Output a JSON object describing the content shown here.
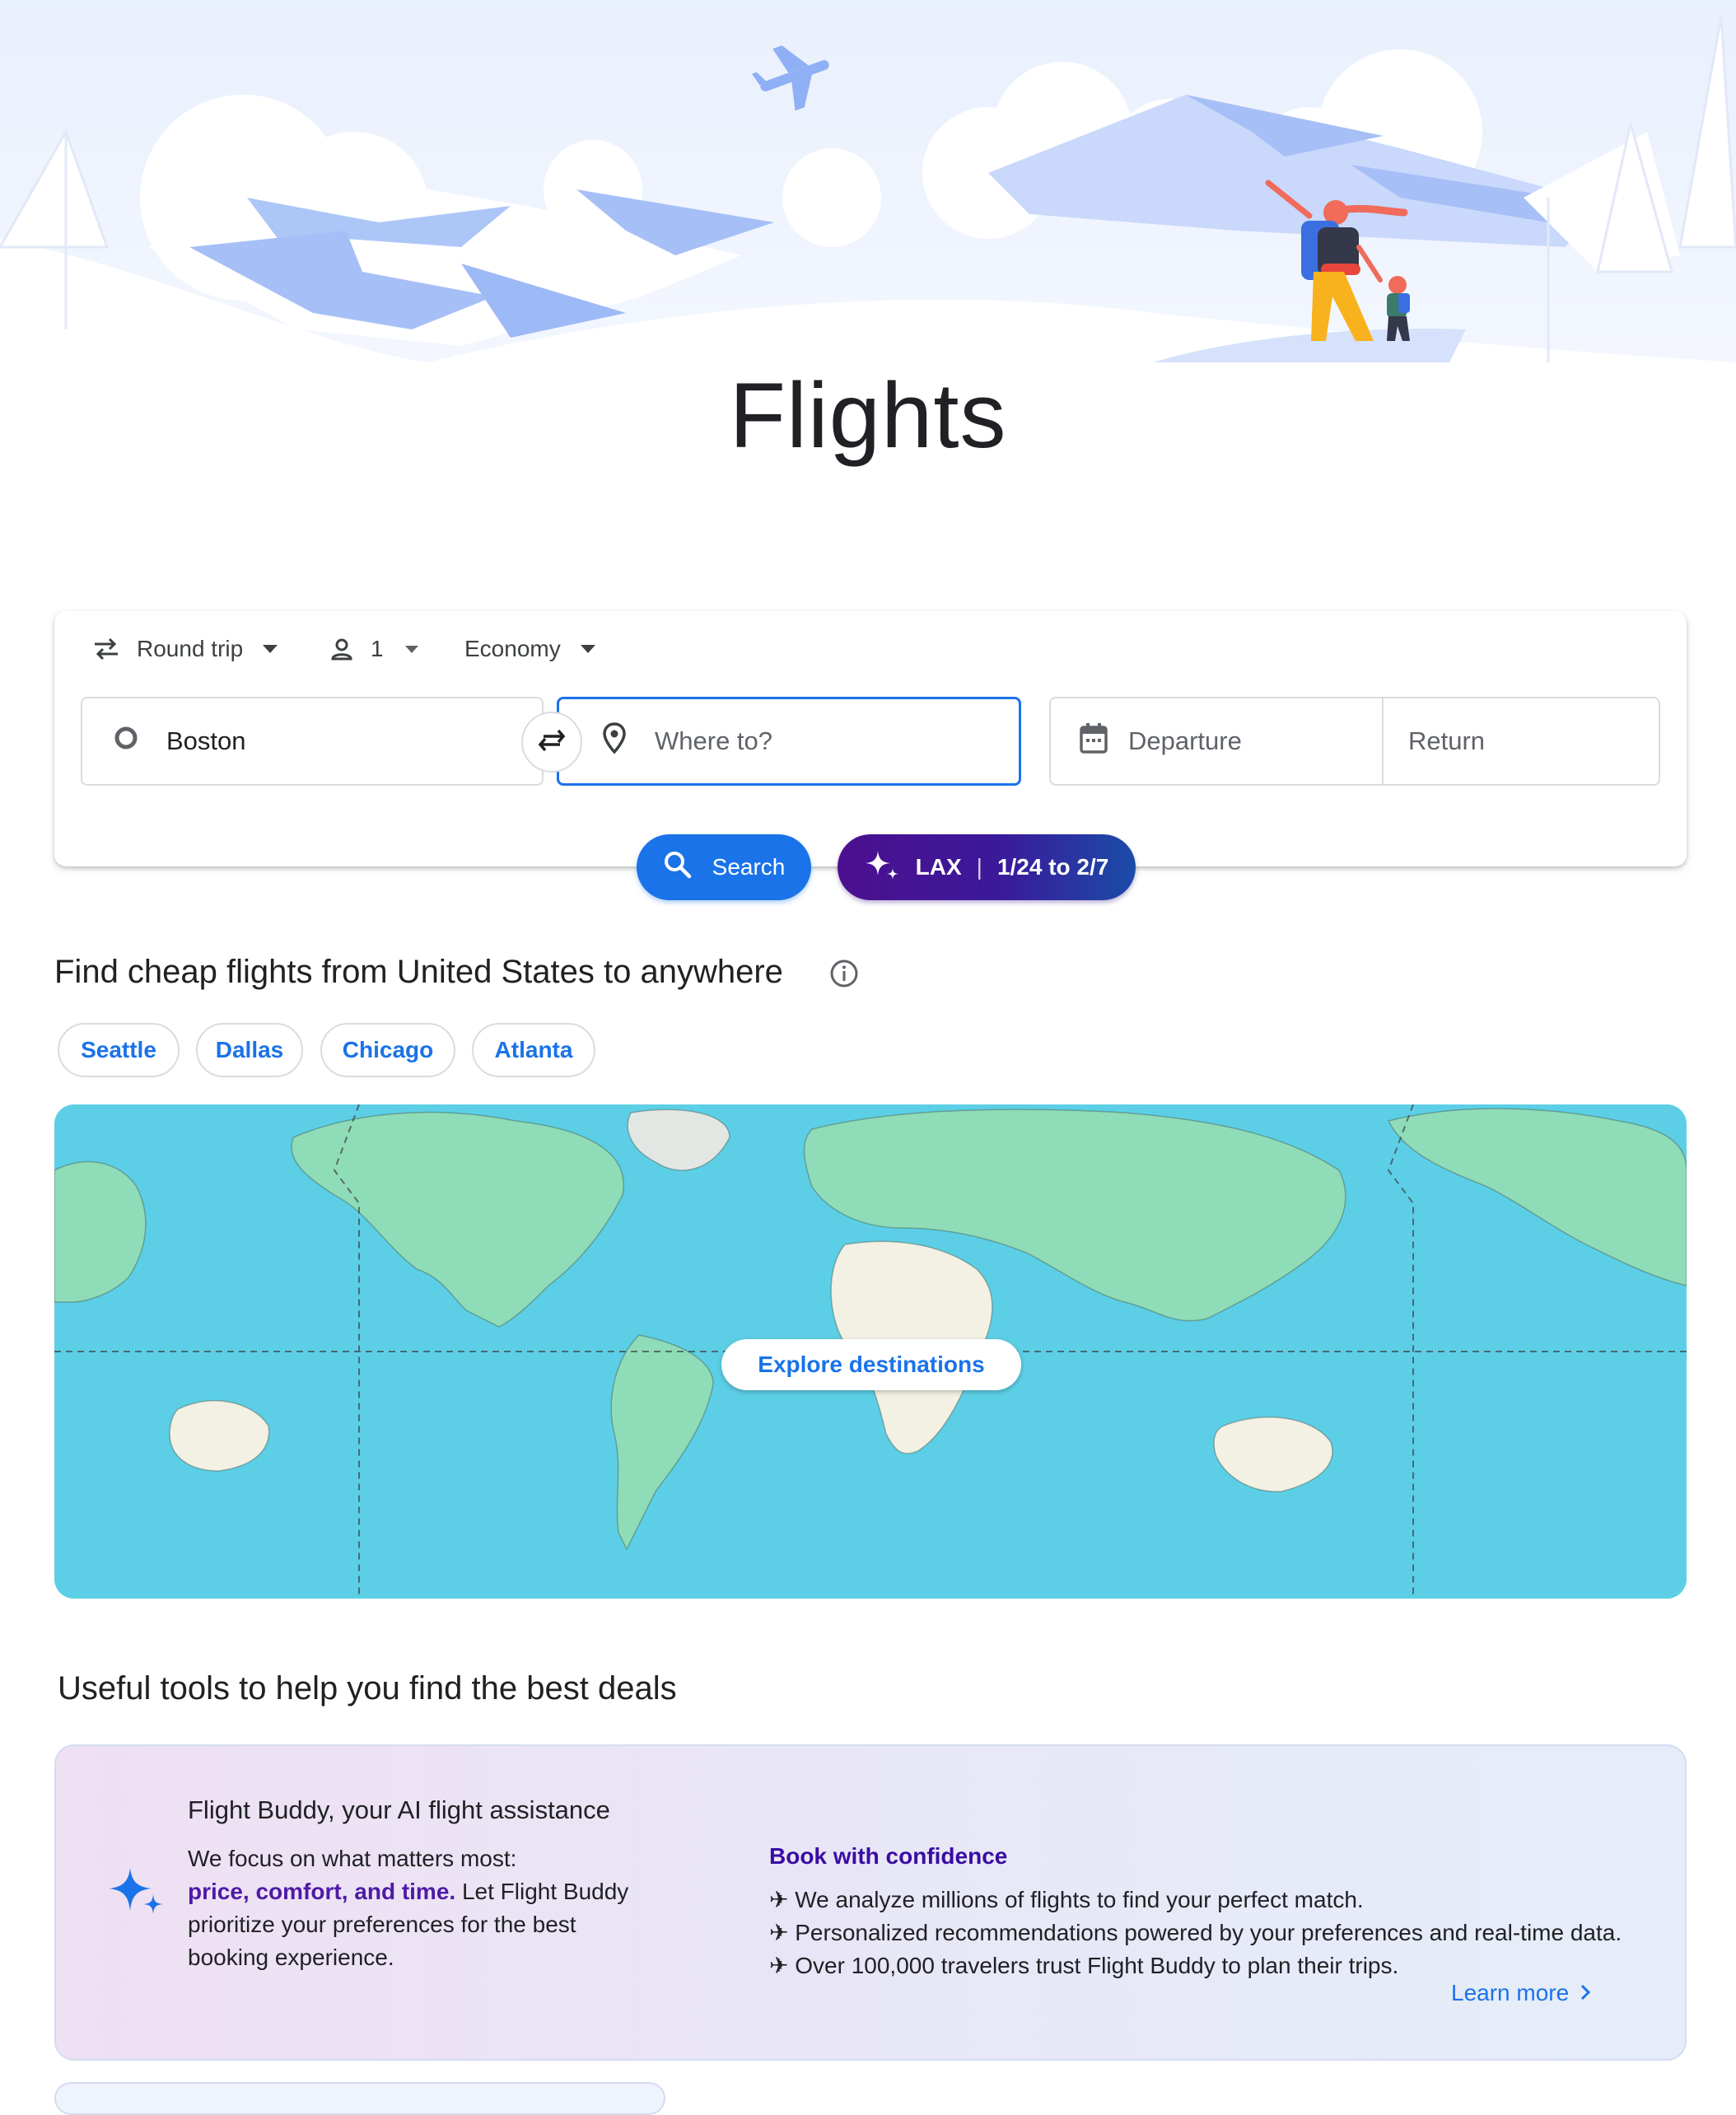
{
  "page": {
    "title": "Flights"
  },
  "trip_options": {
    "trip_type": "Round trip",
    "passengers": "1",
    "cabin_class": "Economy"
  },
  "search_form": {
    "origin_value": "Boston",
    "destination_placeholder": "Where to?",
    "departure_placeholder": "Departure",
    "return_placeholder": "Return",
    "search_label": "Search",
    "suggestion": {
      "airport": "LAX",
      "dates": "1/24 to 2/7"
    }
  },
  "cheap_flights": {
    "title": "Find cheap flights from United States to anywhere",
    "cities": [
      "Seattle",
      "Dallas",
      "Chicago",
      "Atlanta"
    ],
    "explore_label": "Explore destinations"
  },
  "tools": {
    "title": "Useful tools to help you find the best deals",
    "buddy": {
      "title": "Flight Buddy, your AI flight assistance",
      "desc_intro": "We focus on what matters most:",
      "desc_emphasis": "price, comfort, and time.",
      "desc_rest": "Let Flight Buddy prioritize your preferences for the best booking experience.",
      "confidence_title": "Book with confidence",
      "bullets": [
        "We analyze millions of flights to find your perfect match.",
        "Personalized recommendations powered by your preferences and real-time data.",
        "Over 100,000 travelers trust Flight Buddy to plan their trips."
      ],
      "bullet_icon": "airplane-icon",
      "learn_more": "Learn more"
    }
  },
  "colors": {
    "accent": "#1a73e8",
    "map_ocean": "#5ccfe6",
    "ai_gradient_start": "#4c0f8f",
    "ai_gradient_end": "#1a4ca8"
  }
}
